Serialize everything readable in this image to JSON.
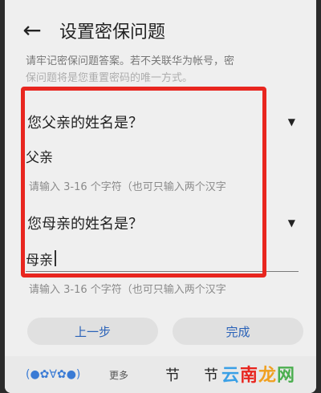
{
  "header": {
    "title": "设置密保问题"
  },
  "notice": {
    "line1": "请牢记密保问题答案。若不关联华为帐号，密",
    "line2": "保问题将是您重置密码的唯一方式。"
  },
  "question1": {
    "text": "您父亲的姓名是？",
    "answer": "父亲",
    "hint": "请输入 3-16 个字符（也可只输入两个汉字"
  },
  "question2": {
    "text": "您母亲的姓名是？",
    "answer": "母亲",
    "hint": "请输入 3-16 个字符（也可只输入两个汉字"
  },
  "buttons": {
    "prev": "上一步",
    "done": "完成"
  },
  "keyboard": {
    "emoticon": "(●✿∀✿●)",
    "more": "更多",
    "candidate1": "节",
    "candidate2": "节"
  },
  "watermark": {
    "c1": "云",
    "c2": "南",
    "c3": "龙",
    "c4": "网"
  },
  "colors": {
    "highlight": "#e8261f",
    "accent": "#2a62b8"
  }
}
